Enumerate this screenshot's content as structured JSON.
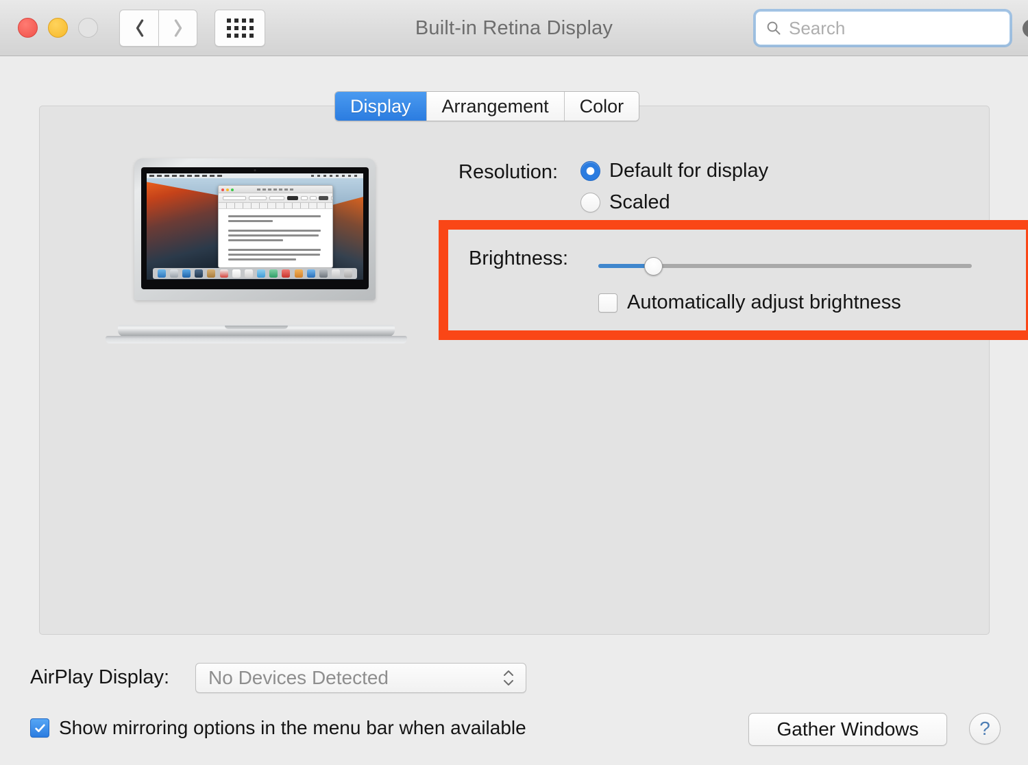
{
  "window": {
    "title": "Built-in Retina Display",
    "traffic_lights": [
      "close",
      "minimize",
      "zoom"
    ]
  },
  "toolbar": {
    "back_icon": "chevron-left-icon",
    "forward_icon": "chevron-right-icon",
    "grid_icon": "grid-view-icon"
  },
  "search": {
    "placeholder": "Search",
    "value": "",
    "icon": "search-icon",
    "clear_icon": "clear-circle-icon"
  },
  "tabs": [
    {
      "label": "Display",
      "active": true
    },
    {
      "label": "Arrangement",
      "active": false
    },
    {
      "label": "Color",
      "active": false
    }
  ],
  "preview": {
    "device": "macbook-pro-retina",
    "screen_app": "TextEdit",
    "wallpaper": "OS X El Capitan"
  },
  "resolution": {
    "label": "Resolution:",
    "options": [
      {
        "label": "Default for display",
        "selected": true
      },
      {
        "label": "Scaled",
        "selected": false
      }
    ]
  },
  "brightness": {
    "label": "Brightness:",
    "slider_value": 13,
    "slider_min": 0,
    "slider_max": 100,
    "auto_adjust_label": "Automatically adjust brightness",
    "auto_adjust_checked": false,
    "highlight_color": "#fa4616"
  },
  "airplay": {
    "label": "AirPlay Display:",
    "selected": "No Devices Detected",
    "options": [
      "No Devices Detected"
    ]
  },
  "mirroring": {
    "label": "Show mirroring options in the menu bar when available",
    "checked": true
  },
  "footer": {
    "gather_windows_label": "Gather Windows",
    "help_label": "?"
  },
  "colors": {
    "accent_blue": "#2b7ce0",
    "highlight_red": "#fa4616",
    "window_bg": "#ececec",
    "panel_bg": "#e3e3e3"
  }
}
